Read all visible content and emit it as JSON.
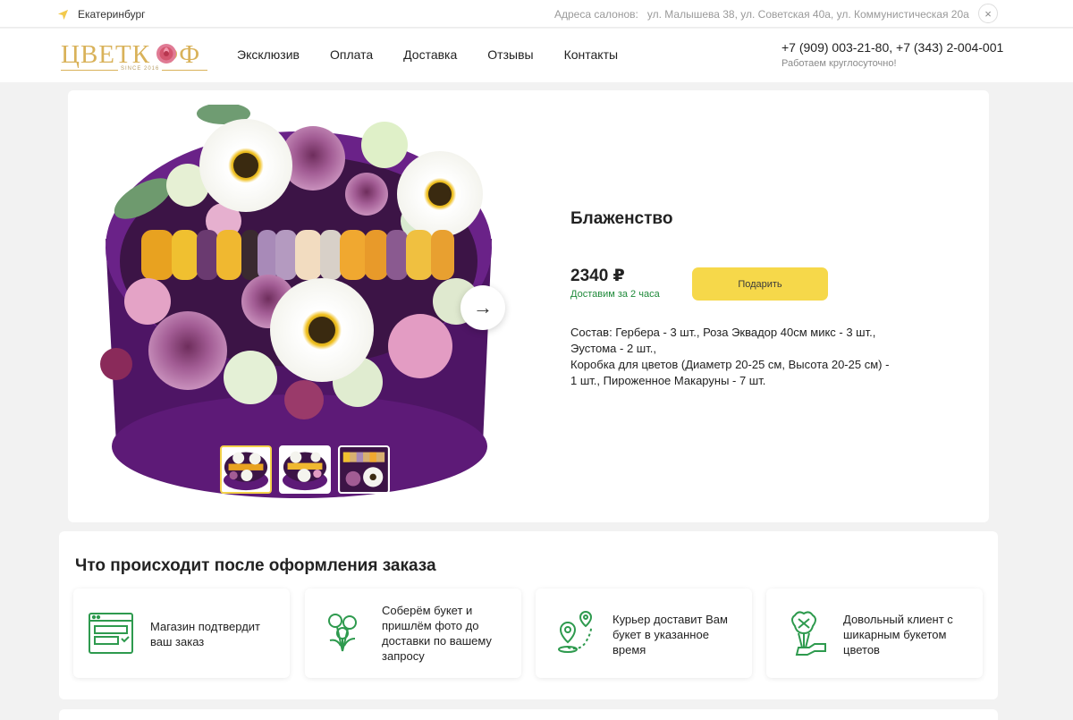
{
  "topbar": {
    "city": "Екатеринбург",
    "address_label": "Адреса салонов:",
    "addresses": "ул. Малышева 38, ул. Советская 40а, ул. Коммунистическая 20а",
    "close": "×"
  },
  "header": {
    "logo_text": "ЦВЕТК  ФФ",
    "logo_since": "SINCE 2016",
    "nav": [
      "Эксклюзив",
      "Оплата",
      "Доставка",
      "Отзывы",
      "Контакты"
    ],
    "phones": "+7 (909) 003-21-80, +7 (343) 2-004-001",
    "hours": "Работаем круглосуточно!"
  },
  "product": {
    "title": "Блаженство",
    "price": "2340 ₽",
    "delivery": "Доставим за 2 часа",
    "gift_button": "Подарить",
    "next_arrow": "→",
    "composition_lines": [
      "Состав: Гербера -  3 шт., Роза Эквадор 40см микс -  3 шт.,",
      "Эустома -  2 шт.,",
      "Коробка для цветов (Диаметр 20-25 см, Высота 20-25 см) -",
      "1 шт., Пироженное Макаруны -  7 шт."
    ]
  },
  "steps": {
    "title": "Что происходит после оформления заказа",
    "items": [
      {
        "text_lines": [
          "Магазин подтвердит",
          "ваш заказ"
        ],
        "icon": "order-form-icon"
      },
      {
        "text_lines": [
          "Соберём букет и",
          "пришлём фото до",
          "доставки по вашему",
          "запросу"
        ],
        "icon": "flowers-icon"
      },
      {
        "text_lines": [
          "Курьер доставит Вам",
          "букет в указанное",
          "время"
        ],
        "icon": "route-pin-icon"
      },
      {
        "text_lines": [
          "Довольный клиент с",
          "шикарным букетом",
          "цветов"
        ],
        "icon": "bouquet-hand-icon"
      }
    ]
  },
  "colors": {
    "accent_yellow": "#f6d84a",
    "logo_gold": "#d9b25a",
    "icon_green": "#2e9a4e",
    "box_purple": "#5a1a6e"
  }
}
